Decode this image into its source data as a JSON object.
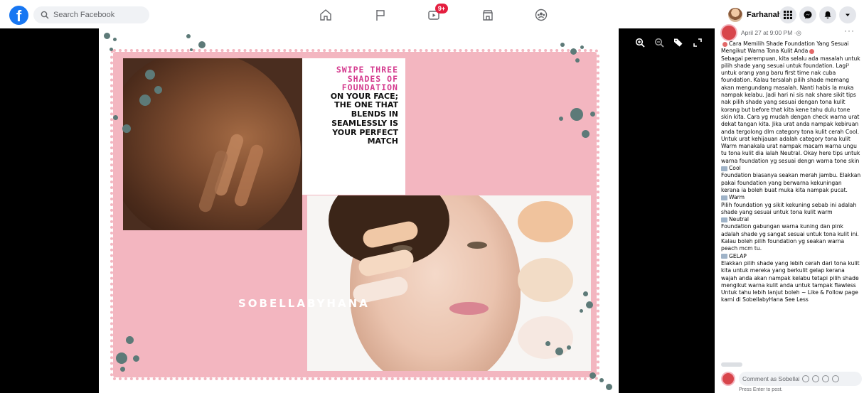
{
  "header": {
    "logo": "f",
    "search_placeholder": "Search Facebook",
    "nav": [
      {
        "name": "home-icon"
      },
      {
        "name": "pages-flag-icon"
      },
      {
        "name": "watch-icon",
        "badge": "9+"
      },
      {
        "name": "marketplace-icon"
      },
      {
        "name": "groups-icon"
      }
    ],
    "profile_name": "Farhanah",
    "actions": [
      "menu-grid-icon",
      "messenger-icon",
      "notifications-bell-icon",
      "account-caret-icon"
    ],
    "accent_color": "#1877f2",
    "badge_color": "#e41e3f"
  },
  "viewer": {
    "tools": [
      "zoom-in-icon",
      "zoom-out-icon",
      "tag-icon",
      "fullscreen-icon"
    ],
    "image": {
      "headline_pink": [
        "SWIPE THREE",
        "SHADES OF",
        "FOUNDATION"
      ],
      "headline_black": [
        "ON YOUR FACE;",
        "THE ONE THAT",
        "BLENDS IN",
        "SEAMLESSLY IS",
        "YOUR PERFECT",
        "MATCH"
      ],
      "brand": "SOBELLABYHANA",
      "frame_color": "#f3b6c0",
      "pink_text_color": "#d43a8e",
      "dot_color": "#5d7a78"
    }
  },
  "post": {
    "date": "April 27 at 9:00 PM · ",
    "more": "···",
    "title": "Cara Memilih Shade Foundation Yang Sesuai Mengikut Warna Tona Kulit Anda",
    "intro": "Sebagai perempuan, kita selalu ada masalah untuk pilih shade yang sesuai untuk foundation. Lagi² untuk orang yang baru first time nak cuba foundation. Kalau tersalah pilih shade memang akan mengundang masalah. Nanti habis la muka nampak kelabu. Jadi hari ni sis nak share sikit tips nak pilih shade yang sesuai dengan tona kulit korang but before that kita kene tahu dulu tone skin kita. Cara yg mudah dengan check warna urat dekat tangan kita. Jika urat anda nampak kebiruan anda tergolong dlm category tona kulit cerah Cool. Untuk urat kehijauan adalah category tona kulit Warm manakala urat nampak macam warna ungu tu tona kulit dia ialah Neutral. Okay here tips untuk warna foundation yg sesuai dengn warna tone skin",
    "sections": [
      {
        "label": "Cool",
        "text": "Foundation biasanya seakan merah jambu. Elakkan pakai foundation yang berwarna kekuningan kerana ia boleh buat muka kita nampak pucat."
      },
      {
        "label": "Warm",
        "text": "Pilih foundation yg sikit kekuning sebab ini adalah shade yang sesuai untuk tona kulit warm"
      },
      {
        "label": "Neutral",
        "text": "Foundation gabungan warna kuning dan pink adalah shade yg sangat sesuai untuk tona kulit ini. Kalau boleh pilih foundation yg seakan warna peach mcm tu."
      },
      {
        "label": "GELAP",
        "text": "Elakkan pilih shade yang lebih cerah dari tona kulit kita untuk mereka yang berkulit gelap kerana wajah anda akan nampak kelabu tetapi pilih shade mengikut warna kulit anda untuk tampak flawless"
      }
    ],
    "outro": "Untuk tahu lebih lanjut boleh ~ Like & Follow page kami di SobellabyHana",
    "see_less": "See Less",
    "comment_placeholder": "Comment as Sobellab...",
    "press_enter": "Press Enter to post."
  }
}
